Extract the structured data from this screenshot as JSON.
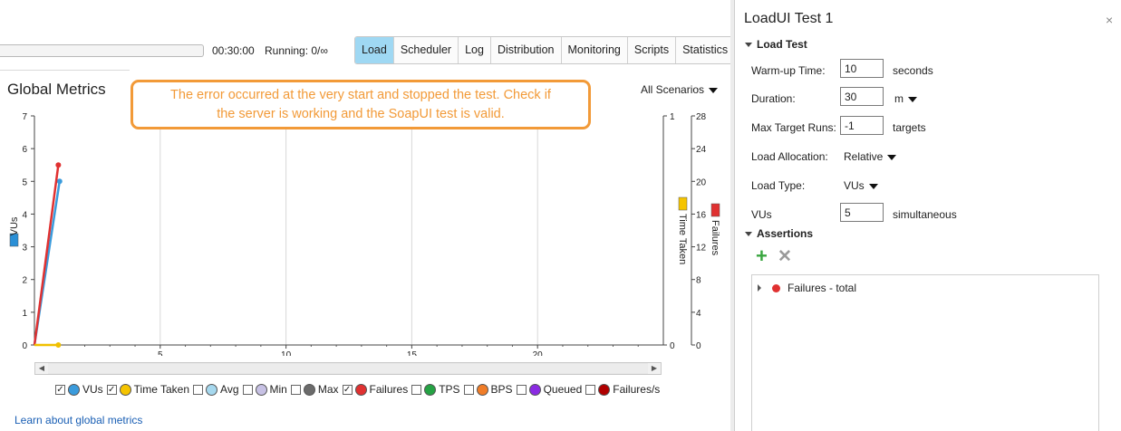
{
  "toolbar": {
    "timer": "00:30:00",
    "running": "Running: 0/∞"
  },
  "tabs": [
    "Load",
    "Scheduler",
    "Log",
    "Distribution",
    "Monitoring",
    "Scripts",
    "Statistics"
  ],
  "active_tab": "Load",
  "metrics": {
    "title": "Global Metrics",
    "scenario_select": "All Scenarios"
  },
  "callout": {
    "line1": "The error occurred at the very start and stopped the test. Check if",
    "line2": "the server is working and the SoapUI test is valid."
  },
  "chart_data": {
    "type": "line",
    "x_ticks": [
      "5",
      "10",
      "15",
      "20"
    ],
    "xlim": [
      0,
      25
    ],
    "left_axis": {
      "label": "VUs",
      "ticks": [
        "0",
        "1",
        "2",
        "3",
        "4",
        "5",
        "6",
        "7"
      ],
      "ylim": [
        0,
        7
      ]
    },
    "right_axis_1": {
      "label": "Time Taken",
      "ticks": [
        "0",
        "1"
      ],
      "ylim": [
        0,
        1
      ]
    },
    "right_axis_2": {
      "label": "Failures",
      "ticks": [
        "0",
        "4",
        "8",
        "12",
        "16",
        "20",
        "24",
        "28"
      ],
      "ylim": [
        0,
        28
      ]
    },
    "series": [
      {
        "name": "VUs",
        "color": "#3a9bdc",
        "axis": "left",
        "x": [
          0,
          1
        ],
        "y": [
          0,
          5
        ]
      },
      {
        "name": "Failures",
        "color": "#e03131",
        "axis": "right2",
        "x": [
          0,
          0.95
        ],
        "y": [
          0,
          22
        ]
      },
      {
        "name": "Time Taken",
        "color": "#f0c000",
        "axis": "right1",
        "x": [
          0,
          0.95
        ],
        "y": [
          0,
          0
        ]
      }
    ],
    "grid": true
  },
  "legend": [
    {
      "label": "VUs",
      "checked": true,
      "color": "#3a9bdc"
    },
    {
      "label": "Time Taken",
      "checked": true,
      "color": "#f5c400"
    },
    {
      "label": "Avg",
      "checked": false,
      "color": "#a6d8ee"
    },
    {
      "label": "Min",
      "checked": false,
      "color": "#c7c1e4"
    },
    {
      "label": "Max",
      "checked": false,
      "color": "#6b6b6b"
    },
    {
      "label": "Failures",
      "checked": true,
      "color": "#e03131"
    },
    {
      "label": "TPS",
      "checked": false,
      "color": "#25a244"
    },
    {
      "label": "BPS",
      "checked": false,
      "color": "#f07d28"
    },
    {
      "label": "Queued",
      "checked": false,
      "color": "#8a2be2"
    },
    {
      "label": "Failures/s",
      "checked": false,
      "color": "#b00000"
    }
  ],
  "learn_link": "Learn about global metrics",
  "panel": {
    "title": "LoadUI Test 1",
    "close": "×",
    "load_test_header": "Load Test",
    "warmup_label": "Warm-up Time:",
    "warmup_value": "10",
    "warmup_unit": "seconds",
    "duration_label": "Duration:",
    "duration_value": "30",
    "duration_unit": "m",
    "max_runs_label": "Max Target Runs:",
    "max_runs_value": "-1",
    "max_runs_unit": "targets",
    "load_alloc_label": "Load Allocation:",
    "load_alloc_value": "Relative",
    "load_type_label": "Load Type:",
    "load_type_value": "VUs",
    "vus_label": "VUs",
    "vus_value": "5",
    "vus_unit": "simultaneous",
    "assertions_header": "Assertions",
    "assertions": [
      "Failures - total"
    ]
  }
}
